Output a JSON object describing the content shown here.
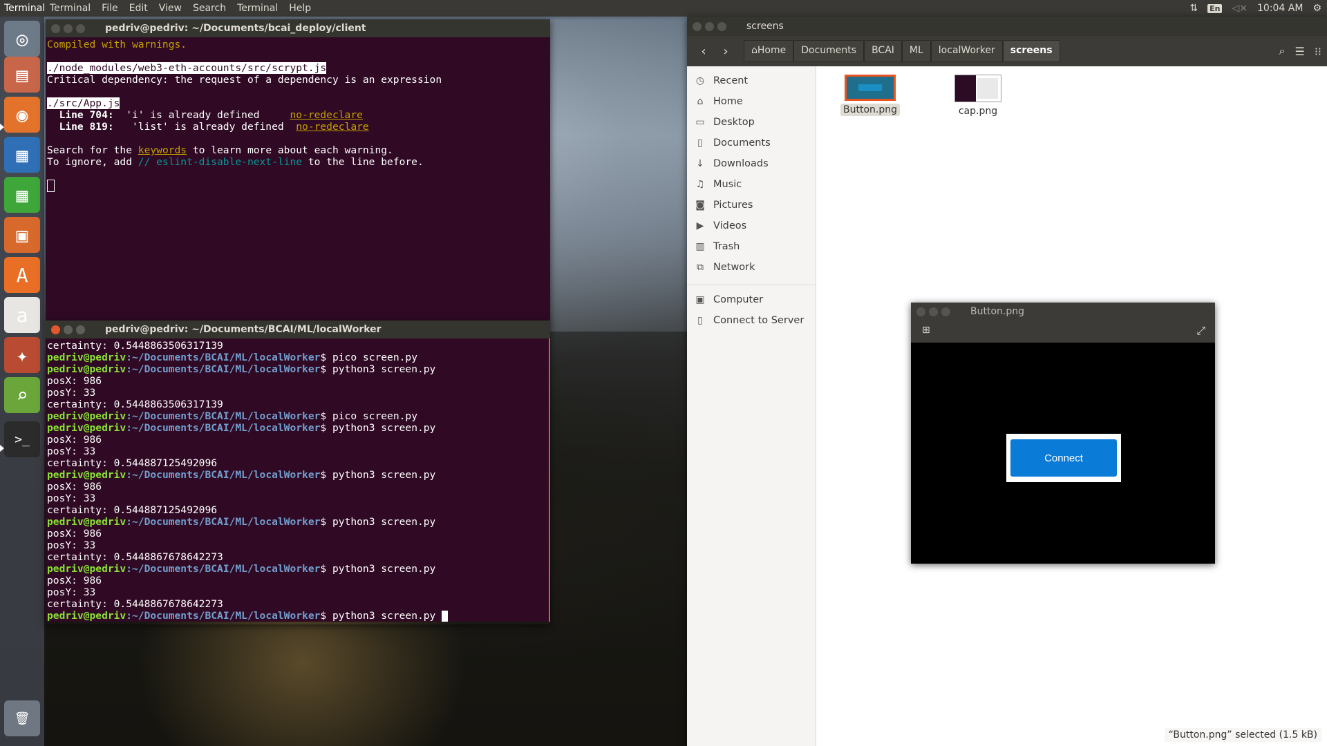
{
  "top_panel": {
    "app_name": "Terminal",
    "menu": [
      "Terminal",
      "File",
      "Edit",
      "View",
      "Search",
      "Terminal",
      "Help"
    ],
    "keyboard_layout": "En",
    "clock": "10:04 AM",
    "icons": [
      "network-transfer-icon",
      "volume-muted-icon",
      "gear-icon"
    ]
  },
  "launcher": {
    "items": [
      {
        "name": "dash-home",
        "icon": "ubuntu-logo-icon",
        "glyph": "◎",
        "bg": "#6d7a88"
      },
      {
        "name": "files",
        "icon": "file-cabinet-icon",
        "glyph": "▤",
        "bg": "#c8664a"
      },
      {
        "name": "firefox",
        "icon": "firefox-icon",
        "glyph": "◉",
        "bg": "#e3732b"
      },
      {
        "name": "writer",
        "icon": "document-icon",
        "glyph": "▦",
        "bg": "#2f6fb5"
      },
      {
        "name": "calc",
        "icon": "spreadsheet-icon",
        "glyph": "▦",
        "bg": "#3fa63a"
      },
      {
        "name": "impress",
        "icon": "presentation-icon",
        "glyph": "▣",
        "bg": "#d8692c"
      },
      {
        "name": "software-center",
        "icon": "shopping-bag-icon",
        "glyph": "A",
        "bg": "#e96f26"
      },
      {
        "name": "amazon",
        "icon": "amazon-icon",
        "glyph": "a",
        "bg": "#e8e6e2"
      },
      {
        "name": "system-settings",
        "icon": "wrench-icon",
        "glyph": "✦",
        "bg": "#b84b32"
      },
      {
        "name": "image-viewer",
        "icon": "magnifier-icon",
        "glyph": "⌕",
        "bg": "#6aa63a"
      },
      {
        "name": "terminal",
        "icon": "terminal-icon",
        "glyph": ">_",
        "bg": "#2b2b2b"
      },
      {
        "name": "trash",
        "icon": "trash-icon",
        "glyph": "🗑",
        "bg": "#6f7782"
      }
    ]
  },
  "terminal1": {
    "title": "pedriv@pedriv: ~/Documents/bcai_deploy/client",
    "compiled": "Compiled with warnings.",
    "module_path": "./node_modules/web3-eth-accounts/src/scrypt.js",
    "critical": "Critical dependency: the request of a dependency is an expression",
    "app_path": "./src/App.js",
    "line1_label": "Line 704:",
    "line1_msg": "'i' is already defined",
    "line1_rule": "no-redeclare",
    "line2_label": "Line 819:",
    "line2_msg": "'list' is already defined",
    "line2_rule": "no-redeclare",
    "search_pre": "Search for the ",
    "search_kw": "keywords",
    "search_post": " to learn more about each warning.",
    "ignore_pre": "To ignore, add ",
    "ignore_comment": "// eslint-disable-next-line",
    "ignore_post": " to the line before."
  },
  "terminal2": {
    "title": "pedriv@pedriv: ~/Documents/BCAI/ML/localWorker",
    "prompt_user": "pedriv@pedriv",
    "prompt_path": ":~/Documents/BCAI/ML/localWorker",
    "lines": [
      {
        "type": "out",
        "text": "certainty: 0.5448863506317139"
      },
      {
        "type": "cmd",
        "text": "$ pico screen.py"
      },
      {
        "type": "cmd",
        "text": "$ python3 screen.py"
      },
      {
        "type": "out",
        "text": "posX: 986"
      },
      {
        "type": "out",
        "text": "posY: 33"
      },
      {
        "type": "out",
        "text": "certainty: 0.5448863506317139"
      },
      {
        "type": "cmd",
        "text": "$ pico screen.py"
      },
      {
        "type": "cmd",
        "text": "$ python3 screen.py"
      },
      {
        "type": "out",
        "text": "posX: 986"
      },
      {
        "type": "out",
        "text": "posY: 33"
      },
      {
        "type": "out",
        "text": "certainty: 0.544887125492096"
      },
      {
        "type": "cmd",
        "text": "$ python3 screen.py"
      },
      {
        "type": "out",
        "text": "posX: 986"
      },
      {
        "type": "out",
        "text": "posY: 33"
      },
      {
        "type": "out",
        "text": "certainty: 0.544887125492096"
      },
      {
        "type": "cmd",
        "text": "$ python3 screen.py"
      },
      {
        "type": "out",
        "text": "posX: 986"
      },
      {
        "type": "out",
        "text": "posY: 33"
      },
      {
        "type": "out",
        "text": "certainty: 0.5448867678642273"
      },
      {
        "type": "cmd",
        "text": "$ python3 screen.py"
      },
      {
        "type": "out",
        "text": "posX: 986"
      },
      {
        "type": "out",
        "text": "posY: 33"
      },
      {
        "type": "out",
        "text": "certainty: 0.5448867678642273"
      },
      {
        "type": "cmd-active",
        "text": "$ python3 screen.py "
      }
    ]
  },
  "file_manager": {
    "title": "screens",
    "breadcrumbs": [
      "Home",
      "Documents",
      "BCAI",
      "ML",
      "localWorker",
      "screens"
    ],
    "sidebar": [
      {
        "label": "Recent",
        "icon": "clock-icon",
        "glyph": "◷"
      },
      {
        "label": "Home",
        "icon": "home-icon",
        "glyph": "⌂"
      },
      {
        "label": "Desktop",
        "icon": "folder-icon",
        "glyph": "▭"
      },
      {
        "label": "Documents",
        "icon": "document-icon",
        "glyph": "▯"
      },
      {
        "label": "Downloads",
        "icon": "download-icon",
        "glyph": "↓"
      },
      {
        "label": "Music",
        "icon": "music-icon",
        "glyph": "♫"
      },
      {
        "label": "Pictures",
        "icon": "camera-icon",
        "glyph": "◙"
      },
      {
        "label": "Videos",
        "icon": "video-icon",
        "glyph": "▶"
      },
      {
        "label": "Trash",
        "icon": "trash-icon",
        "glyph": "▥"
      }
    ],
    "sidebar_network": {
      "label": "Network",
      "icon": "network-icon",
      "glyph": "⧉"
    },
    "sidebar_devices": [
      {
        "label": "Computer",
        "icon": "computer-icon",
        "glyph": "▣"
      },
      {
        "label": "Connect to Server",
        "icon": "server-icon",
        "glyph": "▯"
      }
    ],
    "files": [
      {
        "name": "Button.png",
        "selected": true
      },
      {
        "name": "cap.png",
        "selected": false
      }
    ],
    "status": "“Button.png” selected  (1.5 kB)"
  },
  "image_viewer": {
    "title": "Button.png",
    "button_label": "Connect"
  }
}
